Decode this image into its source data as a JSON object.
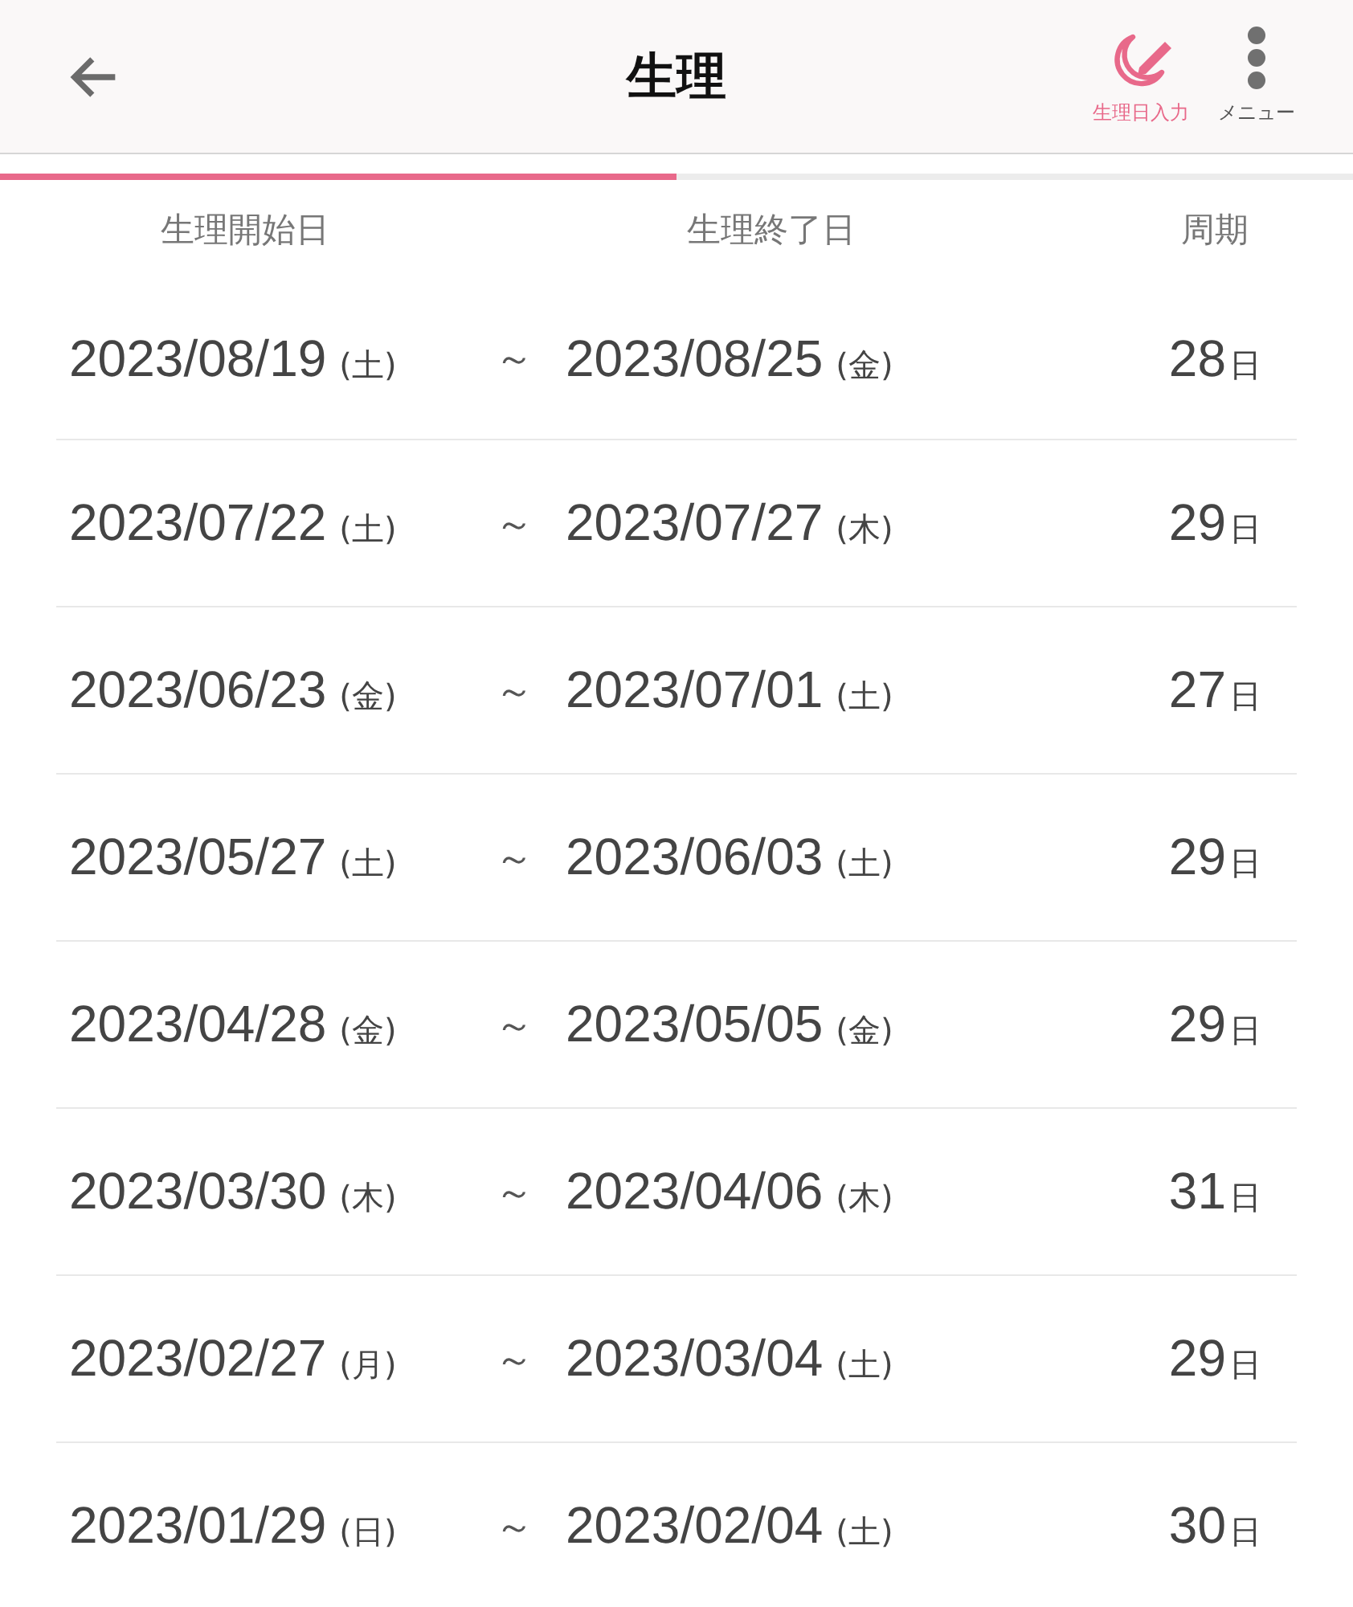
{
  "header": {
    "title": "生理",
    "actions": [
      {
        "kind": "entry",
        "label": "生理日入力"
      },
      {
        "kind": "menu",
        "label": "メニュー"
      }
    ]
  },
  "progress": {
    "level": 0.5
  },
  "table": {
    "columns": [
      "生理開始日",
      "生理終了日",
      "周期"
    ],
    "rows": [
      {
        "start": "2023/08/19",
        "start_day": "(土)",
        "separator": "～",
        "end": "2023/08/25",
        "end_day": "(金)",
        "cycle": "28",
        "unit": "日"
      },
      {
        "start": "2023/07/22",
        "start_day": "(土)",
        "separator": "～",
        "end": "2023/07/27",
        "end_day": "(木)",
        "cycle": "29",
        "unit": "日"
      },
      {
        "start": "2023/06/23",
        "start_day": "(金)",
        "separator": "～",
        "end": "2023/07/01",
        "end_day": "(土)",
        "cycle": "27",
        "unit": "日"
      },
      {
        "start": "2023/05/27",
        "start_day": "(土)",
        "separator": "～",
        "end": "2023/06/03",
        "end_day": "(土)",
        "cycle": "29",
        "unit": "日"
      },
      {
        "start": "2023/04/28",
        "start_day": "(金)",
        "separator": "～",
        "end": "2023/05/05",
        "end_day": "(金)",
        "cycle": "29",
        "unit": "日"
      },
      {
        "start": "2023/03/30",
        "start_day": "(木)",
        "separator": "～",
        "end": "2023/04/06",
        "end_day": "(木)",
        "cycle": "31",
        "unit": "日"
      },
      {
        "start": "2023/02/27",
        "start_day": "(月)",
        "separator": "～",
        "end": "2023/03/04",
        "end_day": "(土)",
        "cycle": "29",
        "unit": "日"
      },
      {
        "start": "2023/01/29",
        "start_day": "(日)",
        "separator": "～",
        "end": "2023/02/04",
        "end_day": "(土)",
        "cycle": "30",
        "unit": "日"
      }
    ]
  }
}
